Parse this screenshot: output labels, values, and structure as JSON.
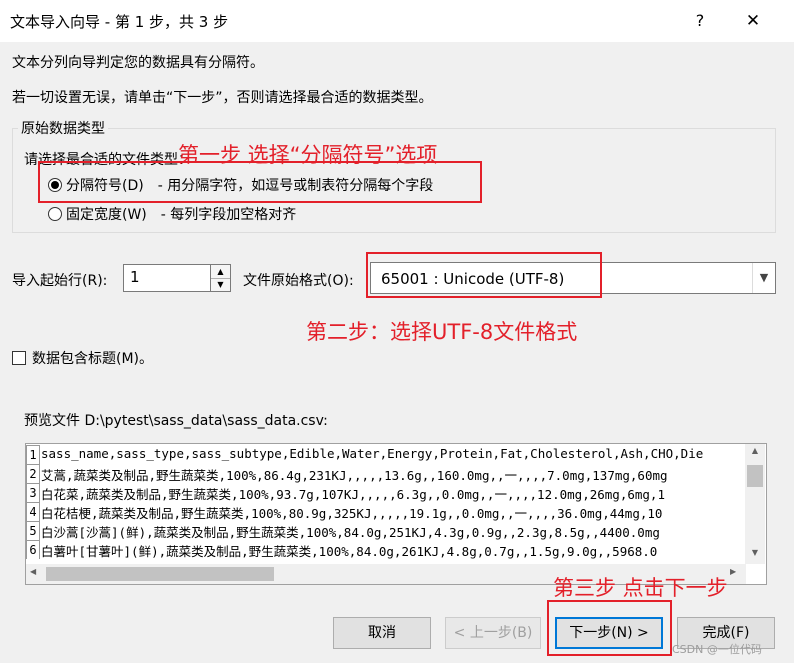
{
  "window": {
    "title": "文本导入向导 - 第 1 步，共 3 步",
    "help_glyph": "?",
    "close_glyph": "✕"
  },
  "intro": {
    "line1": "文本分列向导判定您的数据具有分隔符。",
    "line2": "若一切设置无误，请单击“下一步”，否则请选择最合适的数据类型。"
  },
  "data_type_group": {
    "legend": "原始数据类型",
    "prompt": "请选择最合适的文件类型：",
    "options": [
      {
        "label": "分隔符号(D)",
        "description": "- 用分隔字符，如逗号或制表符分隔每个字段",
        "checked": true
      },
      {
        "label": "固定宽度(W)",
        "description": "- 每列字段加空格对齐",
        "checked": false
      }
    ]
  },
  "import_start": {
    "label": "导入起始行(R):",
    "value": "1"
  },
  "file_origin": {
    "label": "文件原始格式(O):",
    "value": "65001 : Unicode (UTF-8)"
  },
  "headers_checkbox": {
    "label": "数据包含标题(M)。",
    "checked": false
  },
  "preview": {
    "label": "预览文件 D:\\pytest\\sass_data\\sass_data.csv:",
    "rows": [
      {
        "num": "1",
        "text": "sass_name,sass_type,sass_subtype,Edible,Water,Energy,Protein,Fat,Cholesterol,Ash,CHO,Die"
      },
      {
        "num": "2",
        "text": "艾蒿,蔬菜类及制品,野生蔬菜类,100%,86.4g,231KJ,,,,,13.6g,,160.0mg,,一,,,,7.0mg,137mg,60mg"
      },
      {
        "num": "3",
        "text": "白花菜,蔬菜类及制品,野生蔬菜类,100%,93.7g,107KJ,,,,,6.3g,,0.0mg,,一,,,,12.0mg,26mg,6mg,1"
      },
      {
        "num": "4",
        "text": "白花桔梗,蔬菜类及制品,野生蔬菜类,100%,80.9g,325KJ,,,,,19.1g,,0.0mg,,一,,,,36.0mg,44mg,10"
      },
      {
        "num": "5",
        "text": "白沙蒿[沙蒿](鲜),蔬菜类及制品,野生蔬菜类,100%,84.0g,251KJ,4.3g,0.9g,,2.3g,8.5g,,4400.0mg"
      },
      {
        "num": "6",
        "text": "白薯叶[甘薯叶](鲜),蔬菜类及制品,野生蔬菜类,100%,84.0g,261KJ,4.8g,0.7g,,1.5g,9.0g,,5968.0"
      }
    ]
  },
  "buttons": {
    "cancel": "取消",
    "back": "< 上一步(B)",
    "next": "下一步(N) >",
    "finish": "完成(F)"
  },
  "annotations": {
    "step1": "第一步 选择“分隔符号”选项",
    "step2": "第二步：选择UTF-8文件格式",
    "step3": "第三步 点击下一步",
    "color": "#e3202a"
  },
  "watermark": "CSDN @一位代码"
}
